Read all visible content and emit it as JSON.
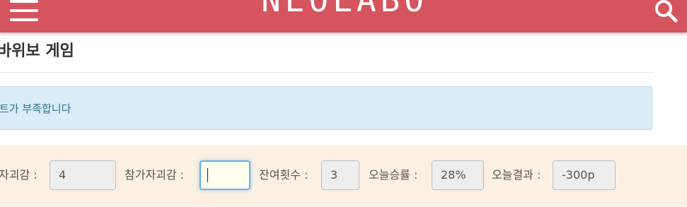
{
  "header": {
    "logo_text": "NEOLABO",
    "menu_icon": "hamburger-menu-icon",
    "search_icon": "search-icon",
    "brand_color": "#d6545e"
  },
  "page": {
    "title": "바위보 게임"
  },
  "alert": {
    "message": "트가 부족합니다",
    "color": "#31708f",
    "background": "#d8edf7"
  },
  "stats": {
    "background": "#fcf0e2",
    "fields": [
      {
        "label": "자괴감 :",
        "value": "4"
      },
      {
        "label": "참가자괴감 :",
        "value": ""
      },
      {
        "label": "잔여횟수 :",
        "value": "3"
      },
      {
        "label": "오늘승률 :",
        "value": "28%"
      },
      {
        "label": "오늘결과 :",
        "value": "-300p"
      }
    ]
  }
}
